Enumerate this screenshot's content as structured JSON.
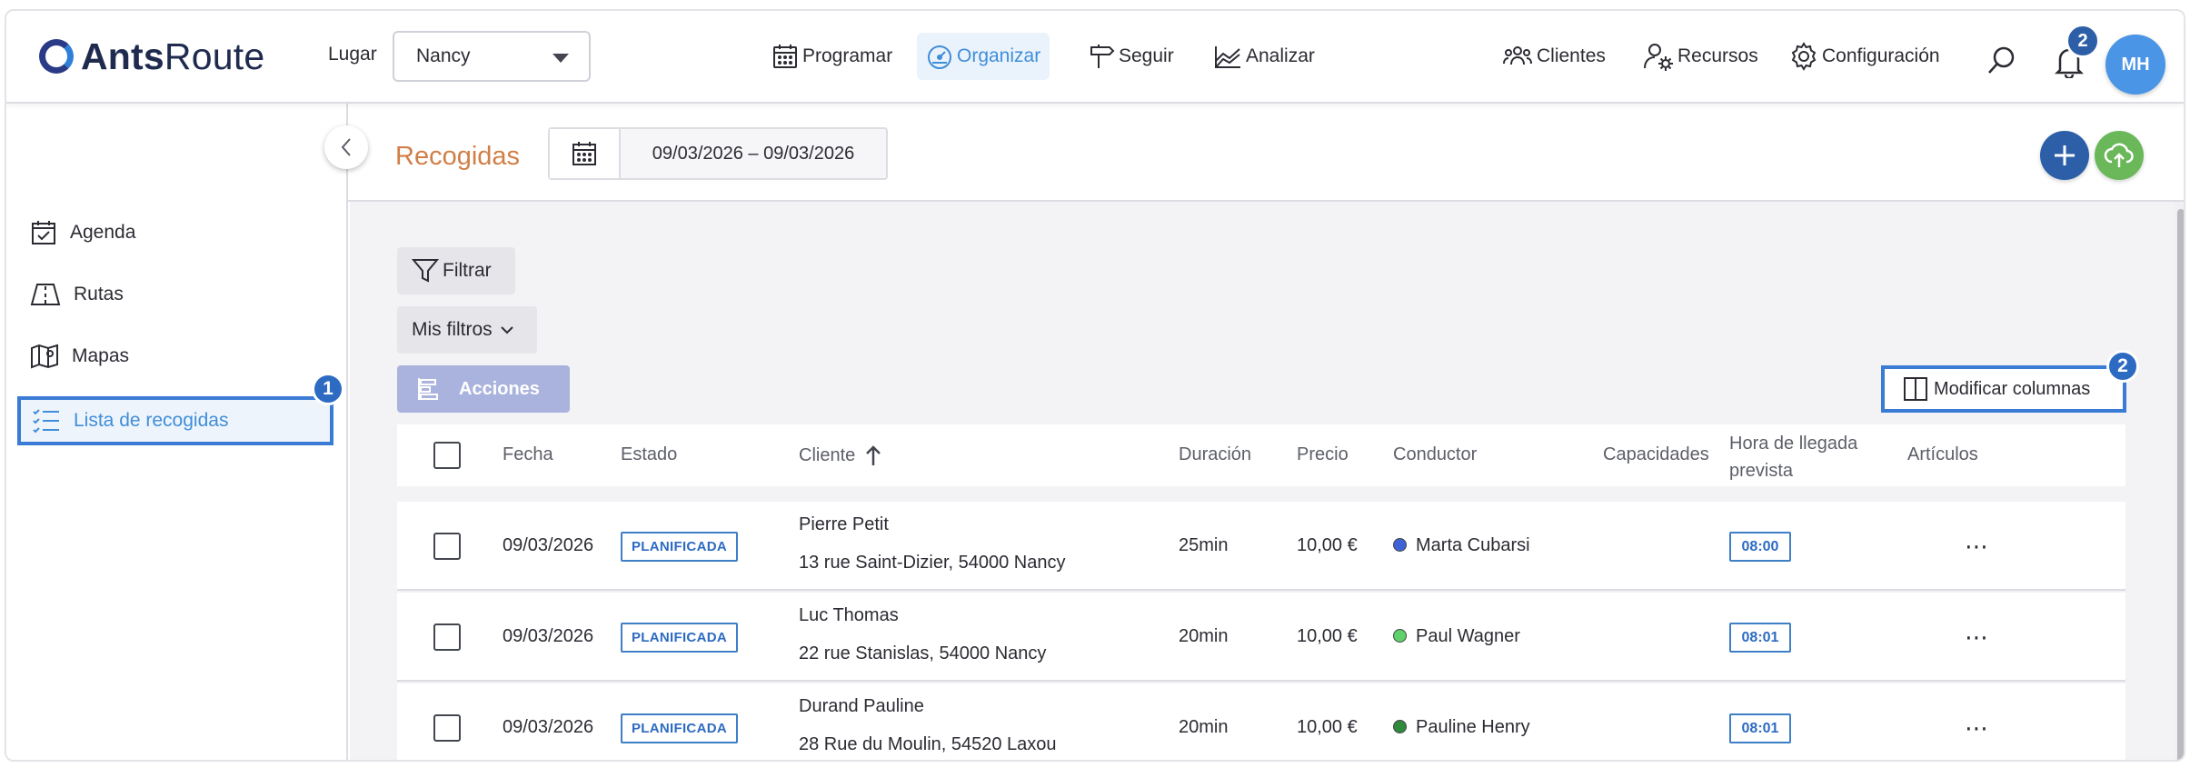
{
  "app": {
    "logo_bold": "Ants",
    "logo_regular": "Route"
  },
  "topbar": {
    "lugar_label": "Lugar",
    "lugar_value": "Nancy",
    "nav": [
      {
        "label": "Programar",
        "icon": "calendar-icon"
      },
      {
        "label": "Organizar",
        "icon": "speedometer-icon",
        "active": true
      },
      {
        "label": "Seguir",
        "icon": "signpost-icon"
      },
      {
        "label": "Analizar",
        "icon": "chart-icon"
      }
    ],
    "right_nav": [
      {
        "label": "Clientes",
        "icon": "people-icon"
      },
      {
        "label": "Recursos",
        "icon": "resource-gear-icon"
      },
      {
        "label": "Configuración",
        "icon": "gear-icon"
      }
    ],
    "notification_count": "2",
    "avatar_initials": "MH"
  },
  "sidebar": {
    "items": [
      {
        "label": "Agenda",
        "icon": "agenda-icon"
      },
      {
        "label": "Rutas",
        "icon": "routes-icon"
      },
      {
        "label": "Mapas",
        "icon": "map-icon"
      },
      {
        "label": "Lista de recogidas",
        "icon": "list-icon",
        "active": true
      }
    ],
    "callout_number": "1"
  },
  "header": {
    "title": "Recogidas",
    "date_range": "09/03/2026 – 09/03/2026"
  },
  "toolbar": {
    "filter_label": "Filtrar",
    "my_filters_label": "Mis filtros",
    "actions_label": "Acciones",
    "modify_columns_label": "Modificar columnas",
    "callout_number": "2"
  },
  "table": {
    "columns": {
      "fecha": "Fecha",
      "estado": "Estado",
      "cliente": "Cliente",
      "duracion": "Duración",
      "precio": "Precio",
      "conductor": "Conductor",
      "capacidades": "Capacidades",
      "hora_line1": "Hora de llegada",
      "hora_line2": "prevista",
      "articulos": "Artículos"
    },
    "rows": [
      {
        "fecha": "09/03/2026",
        "estado": "PLANIFICADA",
        "cliente": "Pierre Petit",
        "direccion": "13 rue Saint-Dizier, 54000 Nancy",
        "duracion": "25min",
        "precio": "10,00 €",
        "conductor": "Marta Cubarsi",
        "conductor_color": "#3f63d6",
        "hora": "08:00"
      },
      {
        "fecha": "09/03/2026",
        "estado": "PLANIFICADA",
        "cliente": "Luc Thomas",
        "direccion": "22 rue Stanislas, 54000 Nancy",
        "duracion": "20min",
        "precio": "10,00 €",
        "conductor": "Paul Wagner",
        "conductor_color": "#5fd16a",
        "hora": "08:01"
      },
      {
        "fecha": "09/03/2026",
        "estado": "PLANIFICADA",
        "cliente": "Durand Pauline",
        "direccion": "28 Rue du Moulin, 54520 Laxou",
        "duracion": "20min",
        "precio": "10,00 €",
        "conductor": "Pauline Henry",
        "conductor_color": "#2f8a3c",
        "hora": "08:01"
      }
    ]
  },
  "colors": {
    "accent": "#3f8ed9",
    "title_orange": "#d17f46",
    "fab_add": "#2d5fa8",
    "fab_upload": "#6ab85a",
    "callout_border": "#3a7bd5"
  }
}
